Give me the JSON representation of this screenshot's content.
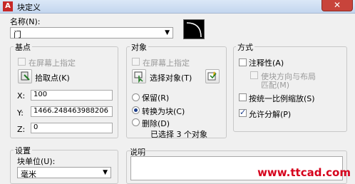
{
  "window": {
    "title": "块定义",
    "close_glyph": "✕"
  },
  "name": {
    "label": "名称(N):",
    "value": "门"
  },
  "base_point": {
    "title": "基点",
    "specify_on_screen": "在屏幕上指定",
    "pick_point": "拾取点(K)",
    "x_label": "X:",
    "x_value": "100",
    "y_label": "Y:",
    "y_value": "1466.248463988206",
    "z_label": "Z:",
    "z_value": "0"
  },
  "objects": {
    "title": "对象",
    "specify_on_screen": "在屏幕上指定",
    "select_objects": "选择对象(T)",
    "retain": "保留(R)",
    "convert_to_block": "转换为块(C)",
    "delete": "删除(D)",
    "selected_count": "已选择 3 个对象",
    "selected_option": "convert_to_block"
  },
  "behavior": {
    "title": "方式",
    "annotative": "注释性(A)",
    "match_orientation_line1": "使块方向与布局",
    "match_orientation_line2": "匹配(M)",
    "scale_uniformly": "按统一比例缩放(S)",
    "allow_exploding": "允许分解(P)",
    "annotative_checked": false,
    "scale_uniformly_checked": false,
    "allow_exploding_checked": true
  },
  "settings": {
    "title": "设置",
    "block_unit_label": "块单位(U):",
    "block_unit_value": "毫米"
  },
  "description": {
    "title": "说明"
  },
  "watermark": "www.ttcad.com"
}
